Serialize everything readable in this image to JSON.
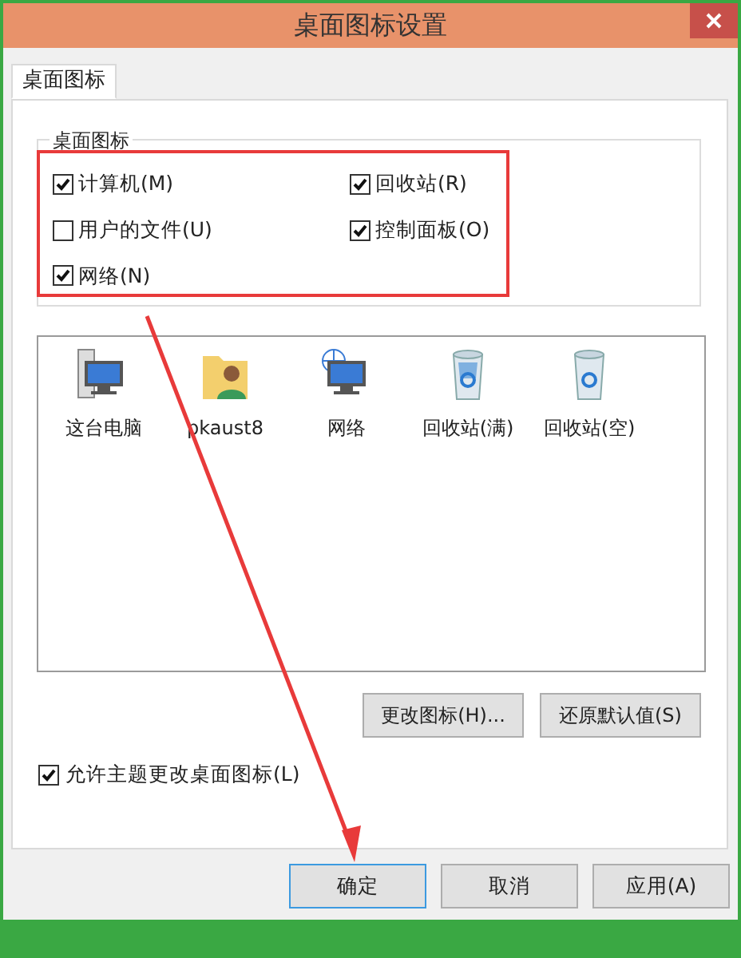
{
  "window": {
    "title": "桌面图标设置"
  },
  "tabs": [
    {
      "label": "桌面图标",
      "selected": true
    }
  ],
  "group": {
    "title": "桌面图标",
    "checkboxes": [
      {
        "label": "计算机(M)",
        "checked": true
      },
      {
        "label": "回收站(R)",
        "checked": true
      },
      {
        "label": "用户的文件(U)",
        "checked": false
      },
      {
        "label": "控制面板(O)",
        "checked": true
      },
      {
        "label": "网络(N)",
        "checked": true
      }
    ]
  },
  "icons": [
    {
      "label": "这台电脑",
      "kind": "computer"
    },
    {
      "label": "pkaust8",
      "kind": "user"
    },
    {
      "label": "网络",
      "kind": "network"
    },
    {
      "label": "回收站(满)",
      "kind": "bin-full"
    },
    {
      "label": "回收站(空)",
      "kind": "bin-empty"
    }
  ],
  "icon_buttons": [
    "更改图标(H)...",
    "还原默认值(S)"
  ],
  "theme_checkbox": {
    "label": "允许主题更改桌面图标(L)",
    "checked": true
  },
  "dialog_buttons": [
    {
      "label": "确定",
      "default": true
    },
    {
      "label": "取消",
      "default": false
    },
    {
      "label": "应用(A)",
      "default": false
    }
  ]
}
